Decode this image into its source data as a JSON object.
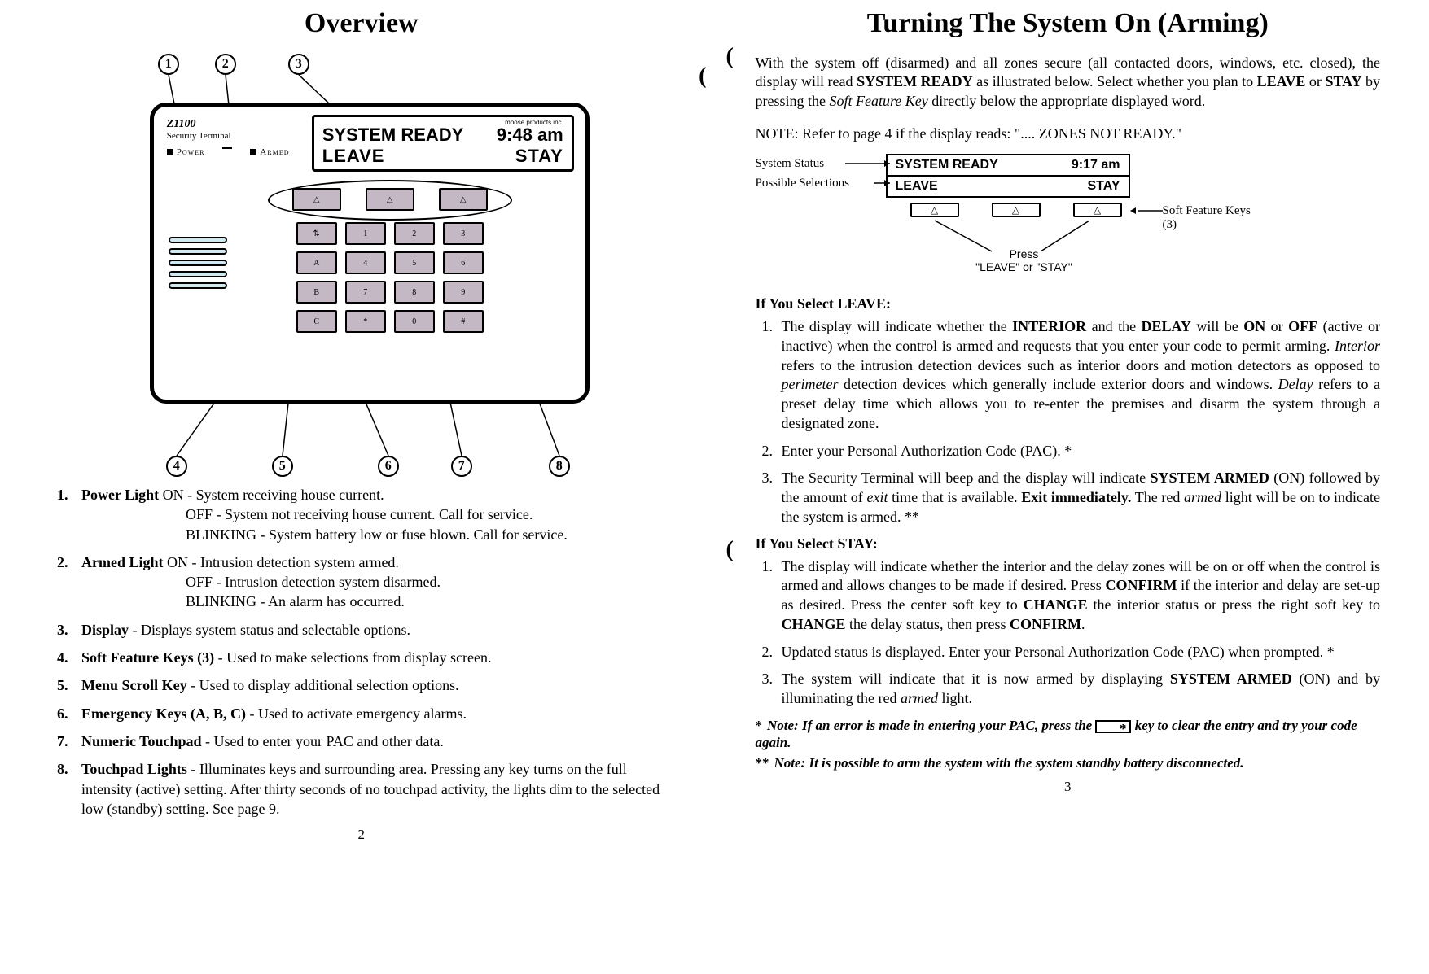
{
  "left": {
    "title": "Overview",
    "lcd": {
      "manufacturer": "moose products inc.",
      "status": "SYSTEM READY",
      "time": "9:48 am",
      "opt_left": "LEAVE",
      "opt_right": "STAY"
    },
    "brand": {
      "model": "Z1100",
      "sub": "Security Terminal",
      "power": "Power",
      "armed": "Armed"
    },
    "callouts": [
      "1",
      "2",
      "3",
      "4",
      "5",
      "6",
      "7",
      "8"
    ],
    "items": [
      {
        "num": "1.",
        "label": "Power Light",
        "lead": " ON - System receiving house current.",
        "lines": [
          "OFF - System not receiving house current. Call for service.",
          "BLINKING - System battery low or fuse blown. Call for service."
        ]
      },
      {
        "num": "2.",
        "label": "Armed Light",
        "lead": " ON - Intrusion detection system armed.",
        "lines": [
          "OFF - Intrusion detection system disarmed.",
          "BLINKING - An alarm has occurred."
        ]
      },
      {
        "num": "3.",
        "label": "Display",
        "lead": " - Displays system status and selectable options.",
        "lines": []
      },
      {
        "num": "4.",
        "label": "Soft Feature Keys (3)",
        "lead": " - Used to make selections from display screen.",
        "lines": []
      },
      {
        "num": "5.",
        "label": "Menu Scroll Key",
        "lead": " - Used to display additional selection options.",
        "lines": []
      },
      {
        "num": "6.",
        "label": "Emergency Keys (A, B, C)",
        "lead": " - Used to activate emergency alarms.",
        "lines": []
      },
      {
        "num": "7.",
        "label": "Numeric Touchpad",
        "lead": " - Used to enter your PAC and other data.",
        "lines": []
      },
      {
        "num": "8.",
        "label": "Touchpad Lights",
        "lead": " - Illuminates keys and surrounding area. Pressing any key turns on the full intensity (active) setting. After thirty seconds of no touchpad activity, the lights dim to the selected low (standby) setting. See page 9.",
        "lines": []
      }
    ],
    "pagenum": "2"
  },
  "right": {
    "title": "Turning The System On (Arming)",
    "intro_parts": {
      "p1": "With the system off (disarmed) and all zones secure (all contacted doors, windows, etc. closed), the display will read ",
      "b1": "SYSTEM READY",
      "p2": " as illustrated below. Select whether you plan to ",
      "b2": "LEAVE",
      "p3": " or ",
      "b3": "STAY",
      "p4": " by pressing the ",
      "i1": "Soft Feature Key",
      "p5": " directly below the appropriate displayed word."
    },
    "note": "NOTE: Refer to page 4 if the display reads: \".... ZONES NOT READY.\"",
    "mini": {
      "label_status": "System Status",
      "label_sel": "Possible Selections",
      "label_soft": "Soft Feature Keys (3)",
      "status": "SYSTEM READY",
      "time": "9:17 am",
      "opt_left": "LEAVE",
      "opt_right": "STAY",
      "press": "Press",
      "press2": "\"LEAVE\" or \"STAY\""
    },
    "sel_leave_head": "If You Select LEAVE:",
    "leave_steps_html": [
      "The display will indicate whether the <b>INTERIOR</b> and the <b>DELAY</b> will be <b>ON</b> or <b>OFF</b> (active or inactive) when the control is armed and requests that you enter your code to permit arming. <i>Interior</i> refers to the intrusion detection devices such as interior doors and motion detectors as opposed to <i>perimeter</i> detection devices which generally include exterior doors and windows. <i>Delay</i> refers to a preset delay time which allows you to re-enter the premises and disarm the system through a designated zone.",
      "Enter your Personal Authorization Code (PAC). *",
      "The Security Terminal will beep and the display will indicate <b>SYSTEM ARMED</b> (ON) followed by the amount of <i>exit</i> time that is available. <b>Exit immediately.</b> The red <i>armed</i> light will be on to indicate the system is armed. **"
    ],
    "sel_stay_head": "If You Select STAY:",
    "stay_steps_html": [
      "The display will indicate whether the interior and the delay zones will be on or off when the control is armed and allows changes to be made if desired. Press <b>CONFIRM</b> if the interior and delay are set-up as desired. Press the center soft key to <b>CHANGE</b> the interior status or press the right soft key to <b>CHANGE</b> the delay status, then press <b>CONFIRM</b>.",
      "Updated status is displayed. Enter your Personal Authorization Code (PAC) when prompted. *",
      "The system will indicate that it is now armed by displaying <b>SYSTEM ARMED</b> (ON) and by illuminating the red <i>armed</i> light."
    ],
    "footnote1_pre": "Note: If an error is made in entering your PAC, press the ",
    "footnote1_post": " key to clear the entry and try your code again.",
    "footnote2": "Note: It is possible to arm the system with the system standby battery disconnected.",
    "pagenum": "3"
  }
}
